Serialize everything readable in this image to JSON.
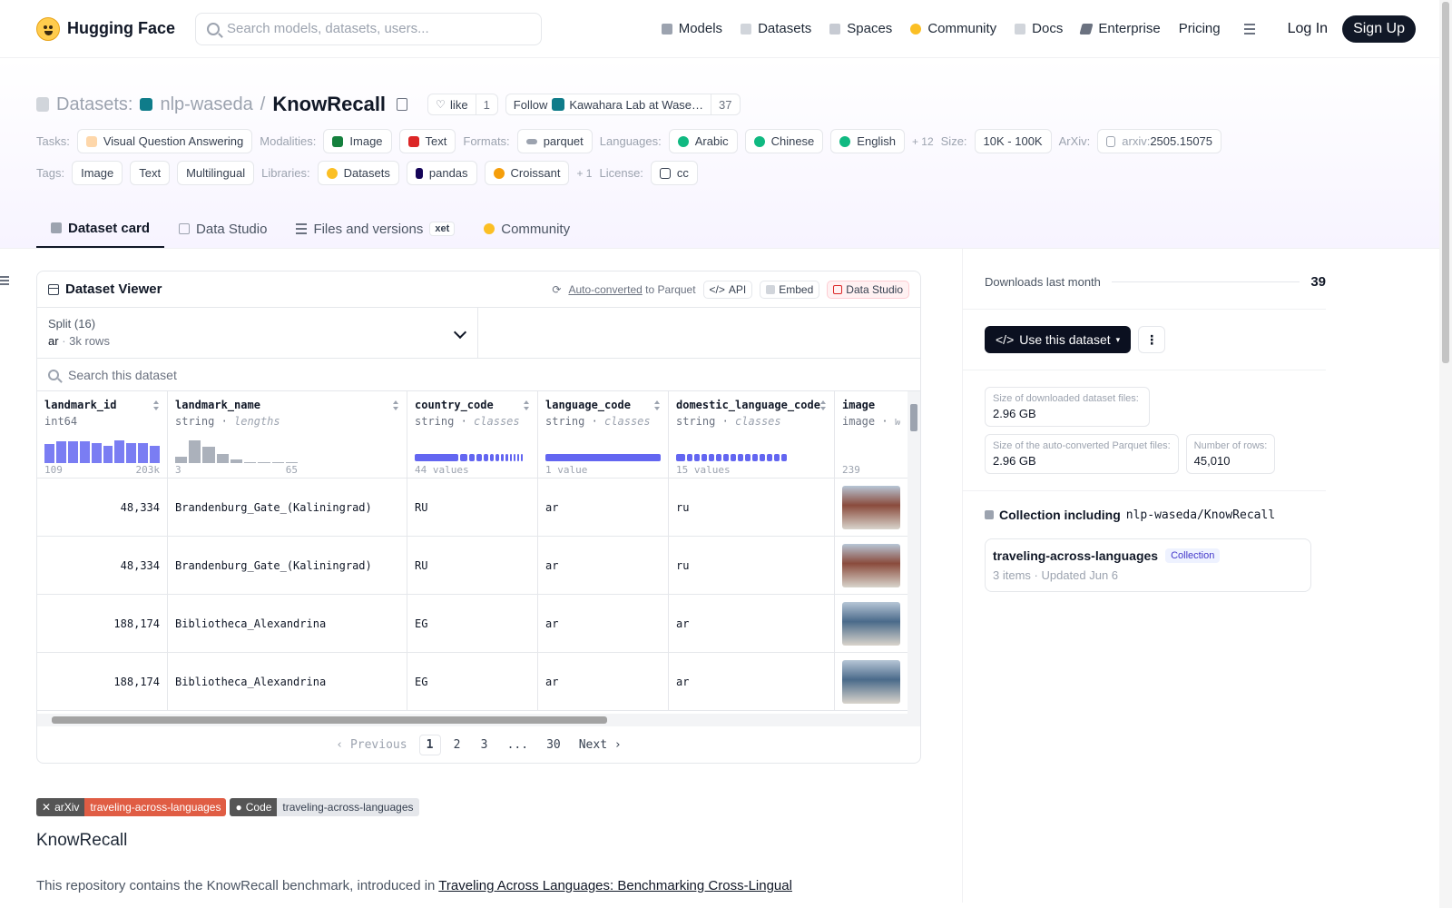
{
  "nav": {
    "brand": "Hugging Face",
    "search_placeholder": "Search models, datasets, users...",
    "links": [
      {
        "label": "Models",
        "icon": "models-icon",
        "color": "#9ca3af"
      },
      {
        "label": "Datasets",
        "icon": "datasets-icon",
        "color": "#d1d5db"
      },
      {
        "label": "Spaces",
        "icon": "spaces-icon",
        "color": "#c7cbd3"
      },
      {
        "label": "Community",
        "icon": "community-icon",
        "color": "#fbbf24"
      },
      {
        "label": "Docs",
        "icon": "docs-icon",
        "color": "#d1d5db"
      },
      {
        "label": "Enterprise",
        "icon": "enterprise-icon",
        "color": "#6b7280"
      },
      {
        "label": "Pricing",
        "icon": "",
        "color": ""
      }
    ],
    "login": "Log In",
    "signup": "Sign Up"
  },
  "header": {
    "prefix": "Datasets:",
    "org": "nlp-waseda",
    "sep": "/",
    "repo": "KnowRecall",
    "like_label": "like",
    "like_count": "1",
    "follow_label": "Follow",
    "follow_org": "Kawahara Lab at Wase…",
    "follow_count": "37",
    "tasks_label": "Tasks:",
    "task": "Visual Question Answering",
    "modalities_label": "Modalities:",
    "modalities": [
      "Image",
      "Text"
    ],
    "formats_label": "Formats:",
    "format": "parquet",
    "languages_label": "Languages:",
    "languages": [
      "Arabic",
      "Chinese",
      "English"
    ],
    "languages_more": "+ 12",
    "size_label": "Size:",
    "size": "10K - 100K",
    "arxiv_label": "ArXiv:",
    "arxiv_prefix": "arxiv:",
    "arxiv_id": "2505.15075",
    "tags_label": "Tags:",
    "tags": [
      "Image",
      "Text",
      "Multilingual"
    ],
    "libraries_label": "Libraries:",
    "libraries": [
      "Datasets",
      "pandas",
      "Croissant"
    ],
    "libraries_more": "+ 1",
    "license_label": "License:",
    "license": "cc"
  },
  "tabs": [
    {
      "label": "Dataset card",
      "active": true
    },
    {
      "label": "Data Studio",
      "active": false
    },
    {
      "label": "Files and versions",
      "active": false,
      "badge": "xet"
    },
    {
      "label": "Community",
      "active": false
    }
  ],
  "viewer": {
    "title": "Dataset Viewer",
    "auto_converted": "Auto-converted",
    "to_parquet": "to Parquet",
    "api": "API",
    "embed": "Embed",
    "data_studio": "Data Studio",
    "split_label": "Split (16)",
    "split_value": "ar",
    "split_rows": "3k rows",
    "search_placeholder": "Search this dataset",
    "columns": [
      {
        "name": "landmark_id",
        "type": "int64",
        "kind": "",
        "range_min": "109",
        "range_max": "203k",
        "hist": [
          0.7,
          0.8,
          0.8,
          0.8,
          0.75,
          0.65,
          0.85,
          0.75,
          0.75,
          0.65
        ]
      },
      {
        "name": "landmark_name",
        "type": "string",
        "kind": "lengths",
        "range_min": "3",
        "range_max": "65",
        "hist": [
          0.25,
          0.85,
          0.6,
          0.35,
          0.12,
          0.05,
          0.04,
          0.04,
          0.04
        ]
      },
      {
        "name": "country_code",
        "type": "string",
        "kind": "classes",
        "summary": "44 values"
      },
      {
        "name": "language_code",
        "type": "string",
        "kind": "classes",
        "summary": "1 value"
      },
      {
        "name": "domestic_language_code",
        "type": "string",
        "kind": "classes",
        "summary": "15 values"
      },
      {
        "name": "image",
        "type": "image",
        "kind": "wid",
        "summary": "239"
      }
    ],
    "rows": [
      {
        "landmark_id": "48,334",
        "landmark_name": "Brandenburg_Gate_(Kaliningrad)",
        "country_code": "RU",
        "language_code": "ar",
        "domestic_language_code": "ru",
        "image_color": "#8a4b3c"
      },
      {
        "landmark_id": "48,334",
        "landmark_name": "Brandenburg_Gate_(Kaliningrad)",
        "country_code": "RU",
        "language_code": "ar",
        "domestic_language_code": "ru",
        "image_color": "#8a4b3c"
      },
      {
        "landmark_id": "188,174",
        "landmark_name": "Bibliotheca_Alexandrina",
        "country_code": "EG",
        "language_code": "ar",
        "domestic_language_code": "ar",
        "image_color": "#4a6a8a"
      },
      {
        "landmark_id": "188,174",
        "landmark_name": "Bibliotheca_Alexandrina",
        "country_code": "EG",
        "language_code": "ar",
        "domestic_language_code": "ar",
        "image_color": "#4a6a8a"
      }
    ],
    "pager": {
      "previous": "Previous",
      "pages": [
        "1",
        "2",
        "3",
        "...",
        "30"
      ],
      "current": "1",
      "next": "Next"
    }
  },
  "card": {
    "badge1_key": "arXiv",
    "badge1_val": "traveling-across-languages",
    "badge1_color": "#e05d44",
    "badge2_key": "Code",
    "badge2_val": "traveling-across-languages",
    "badge2_color": "#e5e7eb",
    "title": "KnowRecall",
    "para_start": "This repository contains the KnowRecall benchmark, introduced in ",
    "para_link": "Traveling Across Languages: Benchmarking Cross-Lingual"
  },
  "sidebar": {
    "downloads_label": "Downloads last month",
    "downloads": "39",
    "use_dataset": "Use this dataset",
    "stats": [
      {
        "label": "Size of downloaded dataset files:",
        "value": "2.96 GB"
      },
      {
        "label": "Size of the auto-converted Parquet files:",
        "value": "2.96 GB"
      },
      {
        "label": "Number of rows:",
        "value": "45,010"
      }
    ],
    "collection_heading": "Collection including",
    "collection_repo": "nlp-waseda/KnowRecall",
    "collection_name": "traveling-across-languages",
    "collection_tag": "Collection",
    "collection_items": "3 items",
    "collection_updated": "Updated Jun 6"
  }
}
